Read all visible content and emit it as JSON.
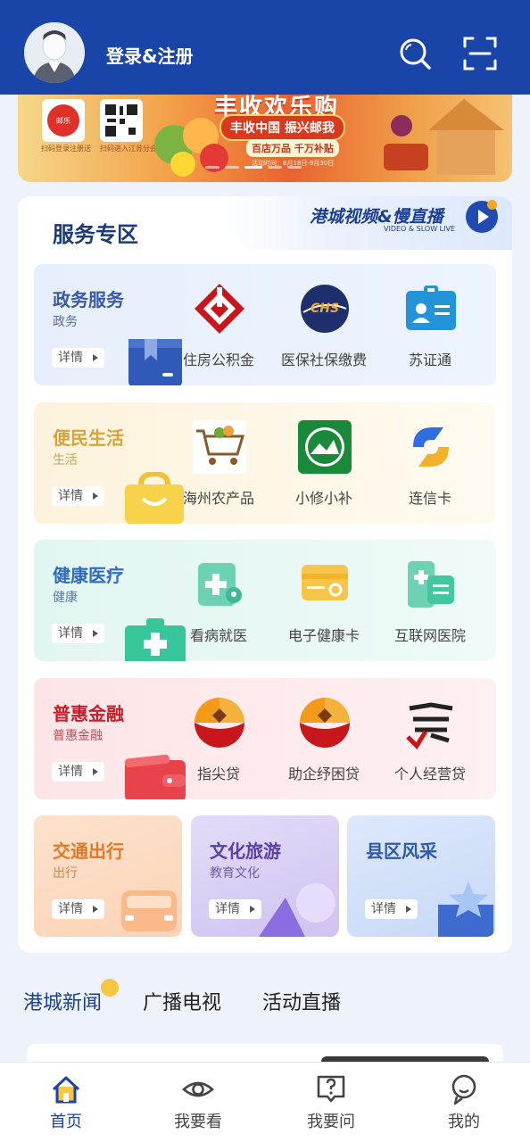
{
  "header": {
    "login_label": "登录&注册",
    "search_icon": "search-icon",
    "scan_icon": "scan-icon",
    "bg_color": "#1a45a8"
  },
  "banner": {
    "title": "丰收欢乐购",
    "pill": "丰收中国 振兴邮我",
    "sub": "百店万品 千万补贴",
    "qr_left_caption": "扫码登录注册送",
    "qr_right_caption": "扫码进入江苏分会场",
    "foot": "活动时间：8月18日-9月30日"
  },
  "services": {
    "title": "服务专区",
    "video_title": "港城视频&慢直播",
    "video_sub": "VIDEO & SLOW LIVE",
    "detail_label": "详情",
    "rows": [
      {
        "title": "政务服务",
        "sub": "政务",
        "color": "#3a5aa8",
        "items": [
          {
            "label": "住房公积金",
            "icon": "housing-fund-icon"
          },
          {
            "label": "医保社保缴费",
            "icon": "chs-icon"
          },
          {
            "label": "苏证通",
            "icon": "id-card-icon"
          }
        ]
      },
      {
        "title": "便民生活",
        "sub": "生活",
        "color": "#d9a23a",
        "items": [
          {
            "label": "海州农产品",
            "icon": "produce-cart-icon"
          },
          {
            "label": "小修小补",
            "icon": "repair-icon"
          },
          {
            "label": "连信卡",
            "icon": "lianxin-card-icon"
          }
        ]
      },
      {
        "title": "健康医疗",
        "sub": "健康",
        "color": "#2f6bbf",
        "items": [
          {
            "label": "看病就医",
            "icon": "medical-visit-icon"
          },
          {
            "label": "电子健康卡",
            "icon": "health-card-icon"
          },
          {
            "label": "互联网医院",
            "icon": "online-hospital-icon"
          }
        ]
      },
      {
        "title": "普惠金融",
        "sub": "普惠金融",
        "color": "#c81e2a",
        "items": [
          {
            "label": "指尖贷",
            "icon": "bank-logo-icon"
          },
          {
            "label": "助企纾困贷",
            "icon": "bank-logo-icon"
          },
          {
            "label": "个人经营贷",
            "icon": "business-loan-icon"
          }
        ]
      }
    ],
    "tiles": [
      {
        "title": "交通出行",
        "sub": "出行",
        "color": "#e07a2a"
      },
      {
        "title": "文化旅游",
        "sub": "教育文化",
        "color": "#5b3fa8"
      },
      {
        "title": "县区风采",
        "sub": "",
        "color": "#2f5aa8"
      }
    ]
  },
  "news_tabs": [
    "港城新闻",
    "广播电视",
    "活动直播"
  ],
  "bottom_nav": [
    {
      "label": "首页",
      "icon": "home-icon",
      "active": true
    },
    {
      "label": "我要看",
      "icon": "eye-icon",
      "active": false
    },
    {
      "label": "我要问",
      "icon": "question-bubble-icon",
      "active": false
    },
    {
      "label": "我的",
      "icon": "profile-icon",
      "active": false
    }
  ]
}
